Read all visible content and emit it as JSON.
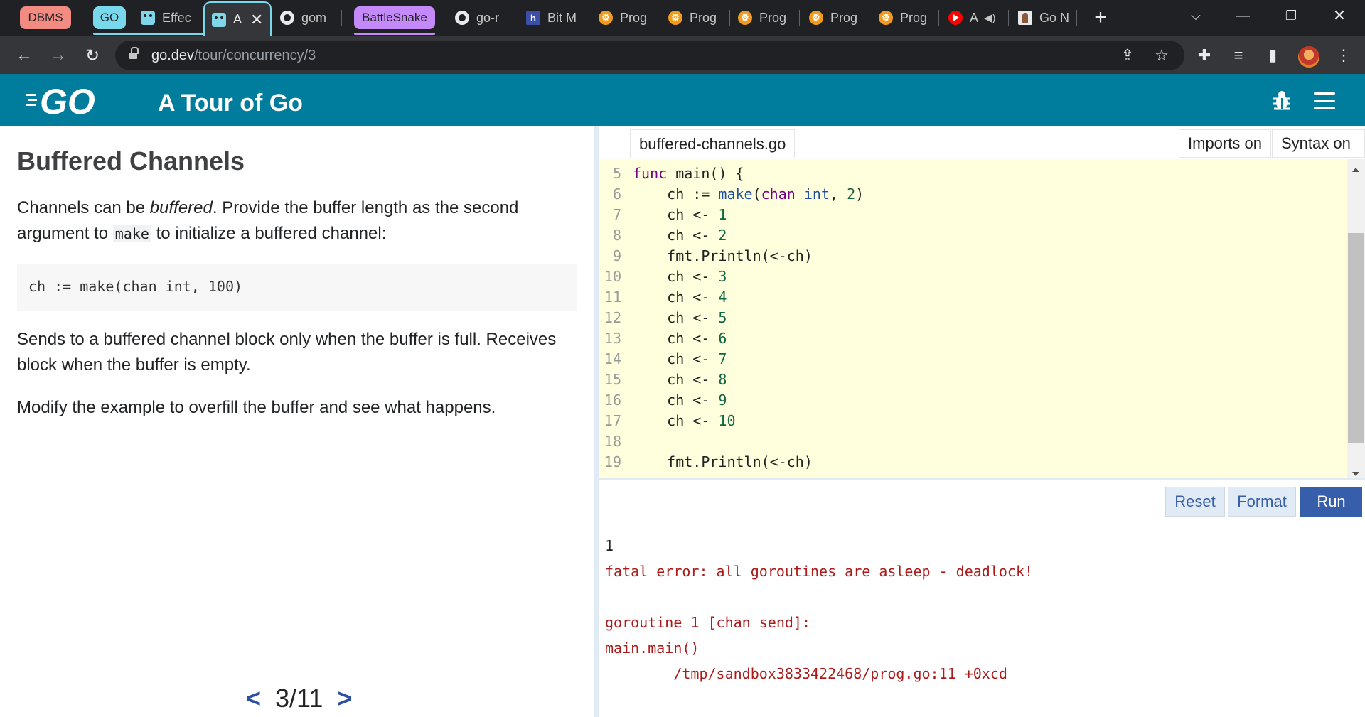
{
  "browser": {
    "tabs": [
      {
        "label": "DBMS",
        "type": "group"
      },
      {
        "label": "GO",
        "type": "group"
      },
      {
        "label": "Effec",
        "icon": "gopher-icon"
      },
      {
        "label": "A",
        "icon": "gopher-icon",
        "active": true
      },
      {
        "label": "gom",
        "icon": "github-icon"
      },
      {
        "label": "BattleSnake",
        "type": "group"
      },
      {
        "label": "go-r",
        "icon": "github-icon"
      },
      {
        "label": "Bit M",
        "icon": "hashnode-icon"
      },
      {
        "label": "Prog",
        "icon": "prog-icon"
      },
      {
        "label": "Prog",
        "icon": "prog-icon"
      },
      {
        "label": "Prog",
        "icon": "prog-icon"
      },
      {
        "label": "Prog",
        "icon": "prog-icon"
      },
      {
        "label": "Prog",
        "icon": "prog-icon"
      },
      {
        "label": "A",
        "icon": "youtube-icon"
      },
      {
        "label": "Go N",
        "icon": "profile-icon"
      }
    ],
    "group_colors": {
      "DBMS": "#f28b82",
      "GO": "#78d9ec",
      "BattleSnake": "#c58af9"
    },
    "url_host": "go.dev",
    "url_path": "/tour/concurrency/3"
  },
  "header": {
    "logo": "GO",
    "title": "A Tour of Go"
  },
  "lesson": {
    "heading": "Buffered Channels",
    "p1_pre": "Channels can be ",
    "p1_em": "buffered",
    "p1_mid": ". Provide the buffer length as the second argument to ",
    "p1_code": "make",
    "p1_post": " to initialize a buffered channel:",
    "code_example": "ch := make(chan int, 100)",
    "p2": "Sends to a buffered channel block only when the buffer is full. Receives block when the buffer is empty.",
    "p3": "Modify the example to overfill the buffer and see what happens.",
    "pager": {
      "prev": "<",
      "current": "3/11",
      "next": ">"
    }
  },
  "editor": {
    "filename": "buffered-channels.go",
    "imports_toggle": "Imports on",
    "syntax_toggle": "Syntax on",
    "lines": [
      {
        "n": "5",
        "text": "func main() {"
      },
      {
        "n": "6",
        "text": "    ch := make(chan int, 2)"
      },
      {
        "n": "7",
        "text": "    ch <- 1"
      },
      {
        "n": "8",
        "text": "    ch <- 2"
      },
      {
        "n": "9",
        "text": "    fmt.Println(<-ch)"
      },
      {
        "n": "10",
        "text": "    ch <- 3"
      },
      {
        "n": "11",
        "text": "    ch <- 4"
      },
      {
        "n": "12",
        "text": "    ch <- 5"
      },
      {
        "n": "13",
        "text": "    ch <- 6"
      },
      {
        "n": "14",
        "text": "    ch <- 7"
      },
      {
        "n": "15",
        "text": "    ch <- 8"
      },
      {
        "n": "16",
        "text": "    ch <- 9"
      },
      {
        "n": "17",
        "text": "    ch <- 10"
      },
      {
        "n": "18",
        "text": ""
      },
      {
        "n": "19",
        "text": "    fmt.Println(<-ch)"
      }
    ]
  },
  "actions": {
    "reset": "Reset",
    "format": "Format",
    "run": "Run"
  },
  "output": [
    {
      "text": "1",
      "kind": "ok"
    },
    {
      "text": "fatal error: all goroutines are asleep - deadlock!",
      "kind": "err"
    },
    {
      "text": "",
      "kind": "err"
    },
    {
      "text": "goroutine 1 [chan send]:",
      "kind": "err"
    },
    {
      "text": "main.main()",
      "kind": "err"
    },
    {
      "text": "\t/tmp/sandbox3833422468/prog.go:11 +0xcd",
      "kind": "err"
    }
  ]
}
